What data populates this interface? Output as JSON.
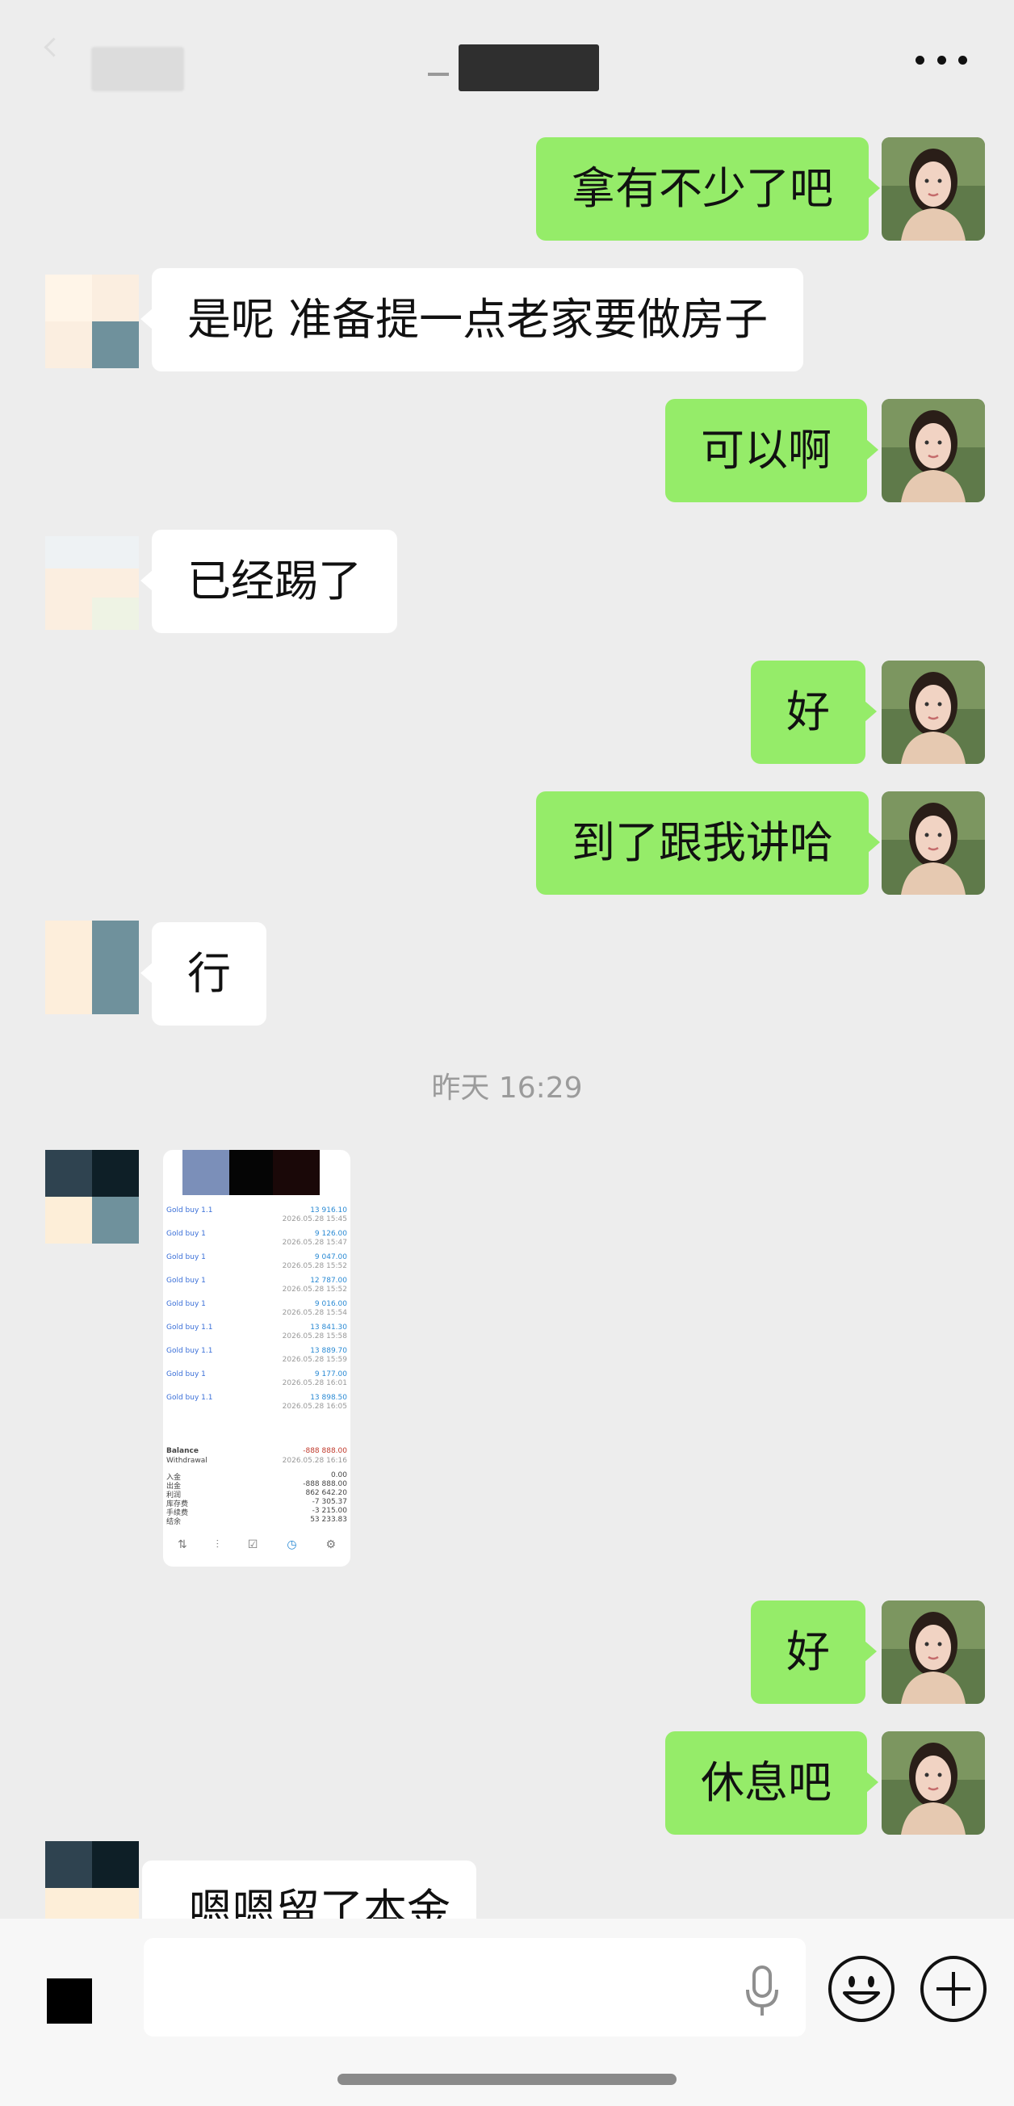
{
  "header": {
    "more_icon": "more-dots-icon"
  },
  "messages": [
    {
      "side": "me",
      "text": "拿有不少了吧"
    },
    {
      "side": "other",
      "text": "是呢 准备提一点老家要做房子"
    },
    {
      "side": "me",
      "text": "可以啊"
    },
    {
      "side": "other",
      "text": "已经踢了"
    },
    {
      "side": "me",
      "text": "好"
    },
    {
      "side": "me",
      "text": "到了跟我讲哈"
    },
    {
      "side": "other",
      "text": "行"
    }
  ],
  "timestamp": "昨天 16:29",
  "screenshot": {
    "trades": [
      {
        "name": "Gold buy 1.1",
        "amount": "13 916.10",
        "date": "2026.05.28 15:45"
      },
      {
        "name": "Gold buy 1",
        "amount": "9 126.00",
        "date": "2026.05.28 15:47"
      },
      {
        "name": "Gold buy 1",
        "amount": "9 047.00",
        "date": "2026.05.28 15:52"
      },
      {
        "name": "Gold buy 1",
        "amount": "12 787.00",
        "date": "2026.05.28 15:52"
      },
      {
        "name": "Gold buy 1",
        "amount": "9 016.00",
        "date": "2026.05.28 15:54"
      },
      {
        "name": "Gold buy 1.1",
        "amount": "13 841.30",
        "date": "2026.05.28 15:58"
      },
      {
        "name": "Gold buy 1.1",
        "amount": "13 889.70",
        "date": "2026.05.28 15:59"
      },
      {
        "name": "Gold buy 1",
        "amount": "9 177.00",
        "date": "2026.05.28 16:01"
      },
      {
        "name": "Gold buy 1.1",
        "amount": "13 898.50",
        "date": "2026.05.28 16:05"
      }
    ],
    "balance_label": "Balance",
    "balance_value": "-888 888.00",
    "withdrawal_label": "Withdrawal",
    "withdrawal_date": "2026.05.28 16:16",
    "summary": [
      {
        "label": "入金",
        "value": "0.00"
      },
      {
        "label": "出金",
        "value": "-888 888.00"
      },
      {
        "label": "利润",
        "value": "862 642.20"
      },
      {
        "label": "库存费",
        "value": "-7 305.37"
      },
      {
        "label": "手续费",
        "value": "-3 215.00"
      },
      {
        "label": "结余",
        "value": "53 233.83"
      }
    ]
  },
  "messages_after": [
    {
      "side": "me",
      "text": "好"
    },
    {
      "side": "me",
      "text": "休息吧"
    },
    {
      "side": "other",
      "text": "嗯嗯留了本金"
    }
  ],
  "input": {
    "voice_icon": "voice-toggle-icon",
    "mic_icon": "microphone-icon",
    "emoji_icon": "emoji-icon",
    "plus_icon": "plus-icon"
  }
}
